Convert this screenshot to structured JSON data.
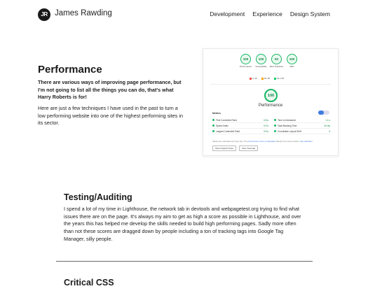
{
  "header": {
    "logo_text": "JR",
    "brand": "James Rawding",
    "nav": [
      "Development",
      "Experience",
      "Design System"
    ]
  },
  "hero": {
    "title": "Performance",
    "lead": "There are various ways of improving page performance, but I'm not going to list all the things you can do, that's what Harry Roberts is for!",
    "body": "Here are just a few techniques I have used in the past to turn a low performing website into one of the highest performing sites in its sector."
  },
  "lighthouse": {
    "gauges": [
      {
        "score": "100",
        "label": "Performance"
      },
      {
        "score": "100",
        "label": "Accessibility"
      },
      {
        "score": "93",
        "label": "Best Practices"
      },
      {
        "score": "100",
        "label": "SEO"
      }
    ],
    "legend": [
      "0–49",
      "50–89",
      "90–100"
    ],
    "legend_colors": [
      "#ff4e42",
      "#ffa400",
      "#0cce6b"
    ],
    "main_score": "100",
    "main_label": "Performance",
    "metrics_title": "Metrics",
    "metrics": [
      {
        "name": "First Contentful Paint",
        "value": "0.8 s"
      },
      {
        "name": "Time to Interactive",
        "value": "1.1 s"
      },
      {
        "name": "Speed Index",
        "value": "0.9 s"
      },
      {
        "name": "Total Blocking Time",
        "value": "20 ms"
      },
      {
        "name": "Largest Contentful Paint",
        "value": "0.9 s"
      },
      {
        "name": "Cumulative Layout Shift",
        "value": "0"
      }
    ],
    "note_prefix": "Values are estimated and may vary. The",
    "note_link": "performance score is calculated",
    "note_suffix": "directly from these metrics.",
    "note_link2": "See calculator.",
    "buttons": [
      "View Original Trace",
      "View Treemap"
    ]
  },
  "testing": {
    "title": "Testing/Auditing",
    "body": "I spend a lot of my time in Lighthouse, the network tab in devtools and webpagetest.org trying to find what issues there are on the page. It's always my aim to get as high a score as possible in Lighthouse, and over the years this has helped me develop the skills needed to build high performing pages. Sadly more often than not these scores are dragged down by people including a ton of tracking tags into Google Tag Manager, silly people."
  },
  "critical": {
    "title": "Critical CSS"
  }
}
